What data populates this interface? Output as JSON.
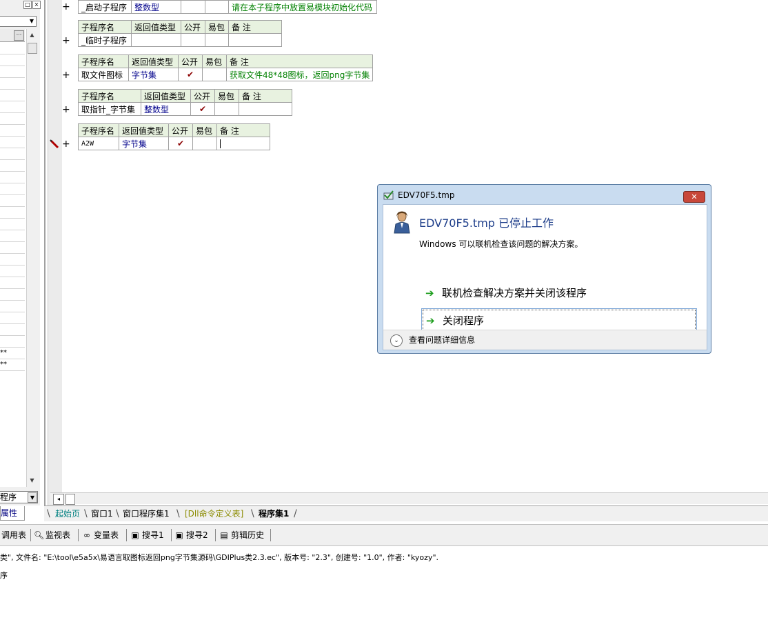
{
  "left_panel": {
    "top_buttons": [
      "□",
      "×"
    ],
    "combo_arrow": "▼",
    "grid_header_button": "···",
    "scroll_up": "▲",
    "scroll_down": "▼",
    "rows_markers": [
      "**",
      "**"
    ],
    "combo2_value": "程序",
    "props_tab": "属性"
  },
  "editor": {
    "tables": [
      {
        "headers": null,
        "row": {
          "name": "_启动子程序",
          "return_type": "整数型",
          "public": "",
          "easy_pack": "",
          "note": "请在本子程序中放置易模块初始化代码"
        }
      },
      {
        "headers": [
          "子程序名",
          "返回值类型",
          "公开",
          "易包",
          "备 注"
        ],
        "row": {
          "name": "_临时子程序",
          "return_type": "",
          "public": "",
          "easy_pack": "",
          "note": ""
        }
      },
      {
        "headers": [
          "子程序名",
          "返回值类型",
          "公开",
          "易包",
          "备 注"
        ],
        "row": {
          "name": "取文件图标",
          "return_type": "字节集",
          "public": "✔",
          "easy_pack": "",
          "note": "获取文件48*48图标，返回png字节集"
        }
      },
      {
        "headers": [
          "子程序名",
          "返回值类型",
          "公开",
          "易包",
          "备 注"
        ],
        "row": {
          "name": "取指针_字节集",
          "return_type": "整数型",
          "public": "✔",
          "easy_pack": "",
          "note": ""
        }
      },
      {
        "headers": [
          "子程序名",
          "返回值类型",
          "公开",
          "易包",
          "备 注"
        ],
        "row": {
          "name": "A2W",
          "return_type": "字节集",
          "public": "✔",
          "easy_pack": "",
          "note": ""
        }
      }
    ],
    "plus": "+",
    "hscroll_left": "◂"
  },
  "doc_tabs": [
    {
      "label": "起始页",
      "color": "#008080"
    },
    {
      "label": "窗口1",
      "color": "#000000"
    },
    {
      "label": "窗口程序集1",
      "color": "#000000"
    },
    {
      "label": "[Dll命令定义表]",
      "color": "#8b8b00"
    },
    {
      "label": "程序集1",
      "color": "#000000"
    }
  ],
  "tool_tabs": [
    {
      "icon": "",
      "label": "调用表"
    },
    {
      "icon": "magnifier-icon",
      "label": "监视表"
    },
    {
      "icon": "glasses-icon",
      "label": "变量表"
    },
    {
      "icon": "find-icon",
      "label": "搜寻1"
    },
    {
      "icon": "find-icon",
      "label": "搜寻2"
    },
    {
      "icon": "clipboard-icon",
      "label": "剪辑历史"
    }
  ],
  "output": {
    "line1": "类\", 文件名: \"E:\\tool\\e5a5x\\易语言取图标返回png字节集源码\\GDIPlus类2.3.ec\", 版本号: \"2.3\", 创建号: \"1.0\", 作者: \"kyozy\".",
    "line2": "序"
  },
  "dialog": {
    "title": "EDV70F5.tmp",
    "close_label": "✕",
    "heading": "EDV70F5.tmp 已停止工作",
    "description": "Windows 可以联机检查该问题的解决方案。",
    "option1": "联机检查解决方案并关闭该程序",
    "option2": "关闭程序",
    "arrow": "➔",
    "details": "查看问题详细信息",
    "expand": "⌄"
  }
}
